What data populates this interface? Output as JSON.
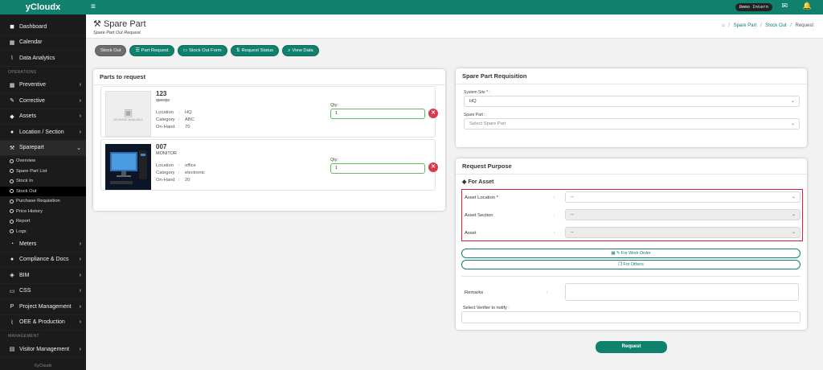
{
  "app": {
    "brand": "yCloudx",
    "demo_label": "Demo Intern"
  },
  "sidebar": {
    "top_items": [
      {
        "icon": "dashboard-icon",
        "label": "Dashboard"
      },
      {
        "icon": "calendar-icon",
        "label": "Calendar"
      },
      {
        "icon": "chart-icon",
        "label": "Data Analytics"
      }
    ],
    "operations_label": "OPERATIONS",
    "op_items": [
      {
        "icon": "calendar-icon",
        "label": "Preventive"
      },
      {
        "icon": "wrench-icon",
        "label": "Corrective"
      },
      {
        "icon": "tag-icon",
        "label": "Assets"
      },
      {
        "icon": "location-icon",
        "label": "Location / Section"
      },
      {
        "icon": "tools-icon",
        "label": "Sparepart"
      }
    ],
    "sparepart_sub": [
      "Overview",
      "Spare Part List",
      "Stock In",
      "Stock Out",
      "Purchase Requisition",
      "Price History",
      "Report",
      "Logs"
    ],
    "more_items": [
      {
        "icon": "meter-icon",
        "label": "Meters"
      },
      {
        "icon": "docs-icon",
        "label": "Compliance & Docs"
      },
      {
        "icon": "bim-icon",
        "label": "BIM"
      },
      {
        "icon": "monitor-icon",
        "label": "CSS"
      },
      {
        "icon": "project-icon",
        "label": "Project Management"
      },
      {
        "icon": "chart-icon",
        "label": "OEE & Production"
      }
    ],
    "management_label": "MANAGEMENT",
    "mgmt_items": [
      {
        "icon": "visitor-icon",
        "label": "Visitor Management"
      }
    ],
    "footer": "©yCloudx"
  },
  "header": {
    "title": "Spare Part",
    "subtitle": "Spare Part Out Request",
    "breadcrumb": [
      "Spare Part",
      "Stock Out",
      "Request"
    ]
  },
  "actions": [
    "Stock Out",
    "Part Request",
    "Stock Out Form",
    "Request Status",
    "View Data"
  ],
  "parts_card": {
    "title": "Parts to request",
    "parts": [
      {
        "code": "123",
        "name": "qweqw",
        "location": "HQ",
        "category": "ABC",
        "on_hand": "70",
        "qty_label": "Qty:",
        "qty": "1",
        "image": "NO IMAGE AVAILABLE"
      },
      {
        "code": "007",
        "name": "MONITOR",
        "location": "office",
        "category": "electronic",
        "on_hand": "20",
        "qty_label": "Qty:",
        "qty": "1",
        "image": ""
      }
    ],
    "labels": {
      "location": "Location",
      "category": "Category",
      "on_hand": "On-Hand",
      "colon": ":"
    }
  },
  "requisition": {
    "title": "Spare Part Requisition",
    "system_site_label": "System Site * :",
    "system_site_value": "HQ",
    "spare_part_label": "Spare Part :",
    "spare_part_placeholder": "Select Spare Part"
  },
  "purpose": {
    "title": "Request Purpose",
    "for_asset": "For Asset",
    "asset_location_label": "Asset Location *",
    "asset_section_label": "Asset Section",
    "asset_label": "Asset",
    "colon": ":",
    "placeholder": "--",
    "for_work_order": "For Work Order",
    "for_others": "For Others",
    "remarks_label": "Remarks",
    "verifier_label": "Select Verifier to notify :",
    "request_button": "Request"
  }
}
